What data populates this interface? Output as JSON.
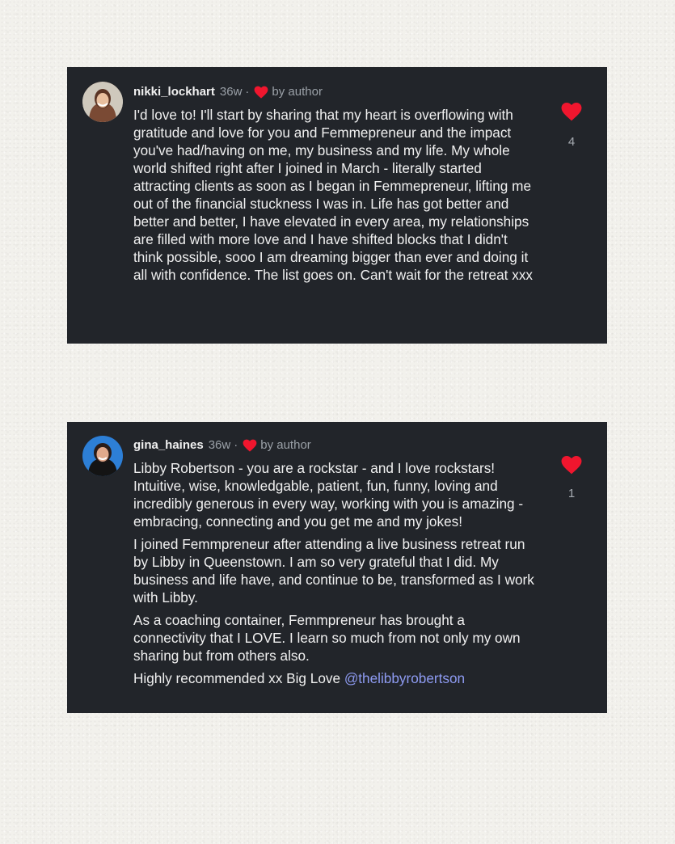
{
  "colors": {
    "background": "#f2f1ec",
    "card": "#22252a",
    "heart": "#f0162e",
    "mention": "#8e9bf2"
  },
  "comments": [
    {
      "avatar_icon": "avatar-photo-woman-smiling",
      "username": "nikki_lockhart",
      "time": "36w",
      "separator": "·",
      "author_like": "by author",
      "paragraphs": [
        "I'd love to! I'll start by sharing that my heart is overflowing with gratitude and love for you and Femmepreneur and the impact you've had/having on me, my business and my life. My whole world shifted right after I joined in March - literally started attracting clients as soon as I began in Femmepreneur, lifting me out of the financial stuckness I was in. Life has got better and better and better, I have elevated in every area, my relationships are filled with more love and I have shifted blocks that I didn't think possible, sooo I am dreaming bigger than ever and doing it all with confidence. The list goes on. Can't wait for the retreat xxx"
      ],
      "like_count": "4"
    },
    {
      "avatar_icon": "avatar-photo-woman-blue-background",
      "username": "gina_haines",
      "time": "36w",
      "separator": "·",
      "author_like": "by author",
      "paragraphs": [
        "Libby Robertson - you are a rockstar - and I love rockstars!  Intuitive, wise, knowledgable, patient, fun, funny, loving and incredibly generous in every way, working with you is amazing - embracing, connecting and you get me and my jokes!",
        "I joined Femmpreneur after attending a live business retreat run by Libby in Queenstown. I am so very grateful that I did. My business and life have, and continue to be, transformed as I work with Libby.",
        "As a coaching container, Femmpreneur has brought a connectivity that I LOVE. I learn so much from not only my own sharing but from others also."
      ],
      "closing_text": "Highly recommended xx Big Love ",
      "mention": "@thelibbyrobertson",
      "like_count": "1"
    }
  ]
}
